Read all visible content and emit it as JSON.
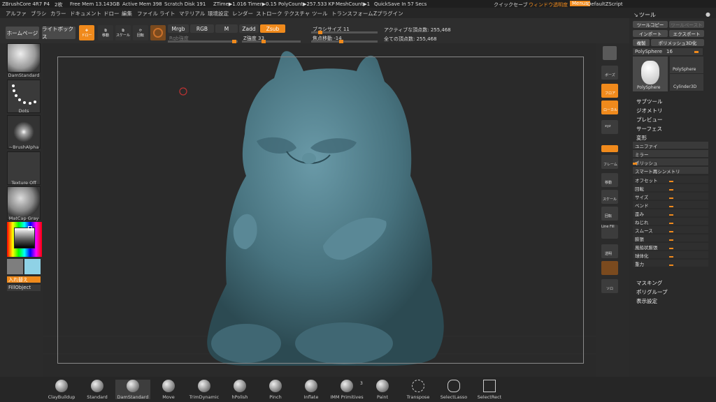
{
  "topbar": {
    "app": "ZBrushCore 4R7 P4",
    "n": "2枚",
    "free_mem": "Free Mem 13.143GB",
    "active_mem": "Active Mem 398",
    "scratch": "Scratch Disk 191",
    "ztime": "ZTime▶1.016 Timer▶0.15",
    "polycount": "PolyCount▶257.533 KP",
    "meshcount": "MeshCount▶1",
    "quicksave": "QuickSave In 57 Secs",
    "quick": "クイックセーブ",
    "transparency": "ウィンドウ透明度",
    "menus": "Menus",
    "script": "DefaultZScript"
  },
  "menubar": [
    "アルファ",
    "ブラシ",
    "カラー",
    "ドキュメント",
    "ドロー",
    "編集",
    "ファイル",
    "ライト",
    "マテリアル",
    "環境設定",
    "レンダー",
    "ストローク",
    "テクスチャ",
    "ツール",
    "トランスフォーム",
    "Zプラグイン"
  ],
  "toolbar": {
    "home": "ホームページ",
    "lightbox": "ライトボックス",
    "draw": "ドロー",
    "move": "移動",
    "scale": "スケール",
    "rotate": "回転",
    "mrgb": "Mrgb",
    "rgb": "RGB",
    "m": "M",
    "zadd": "Zadd",
    "zsub": "Zsub",
    "rgb_intensity": "Rgb強度",
    "z_intensity": "Z強度 33",
    "brush_size": "ブラシサイズ 11",
    "focal_shift": "焦点移動 -14",
    "active_points": "アクティブな頂点数: 255,468",
    "total_points": "全ての頂点数: 255,468"
  },
  "left": {
    "brush": "DamStandard",
    "stroke": "Dots",
    "alpha": "~BrushAlpha",
    "texture": "Texture Off",
    "material": "MatCap Gray",
    "swap": "入れ替え",
    "fill": "FillObject"
  },
  "shelf": [
    "ファイル",
    "ボーズ",
    "フロア",
    "ローカル",
    "xyz",
    "",
    "フレーム",
    "移動",
    "スケール",
    "回転",
    "Line Fill",
    "透明",
    "",
    "ソロ"
  ],
  "right": {
    "title": "ツール",
    "copy": "ツールコピー",
    "paste": "ツールペースト",
    "import": "インポート",
    "export": "エクスポート",
    "clone": "複製",
    "make3d": "ポリメッシュ3D化",
    "poly_label": "PolySphere",
    "poly_value": "16",
    "tool1": "PolySphere",
    "tool2": "PolySphere",
    "tool3": "Cylinder3D",
    "subtool": "サブツール",
    "geometry": "ジオメトリ",
    "preview": "プレビュー",
    "surface": "サーフェス",
    "deform": "変形",
    "rows": [
      "ユニファイ",
      "ミラー",
      "ポリッシュ",
      "スマート再シンメトリ",
      "オフセット",
      "回転",
      "サイズ",
      "ベンド",
      "歪み",
      "ねじれ",
      "スムース",
      "膨張",
      "風船状膨張",
      "球体化",
      "重力"
    ],
    "masking": "マスキング",
    "polygroups": "ポリグループ",
    "display": "表示設定"
  },
  "brushes": [
    "ClayBuildup",
    "Standard",
    "DamStandard",
    "Move",
    "TrimDynamic",
    "hPolish",
    "Pinch",
    "Inflate",
    "IMM Primitives",
    "Paint",
    "Transpose",
    "SelectLasso",
    "SelectRect"
  ],
  "imm_count": "3"
}
